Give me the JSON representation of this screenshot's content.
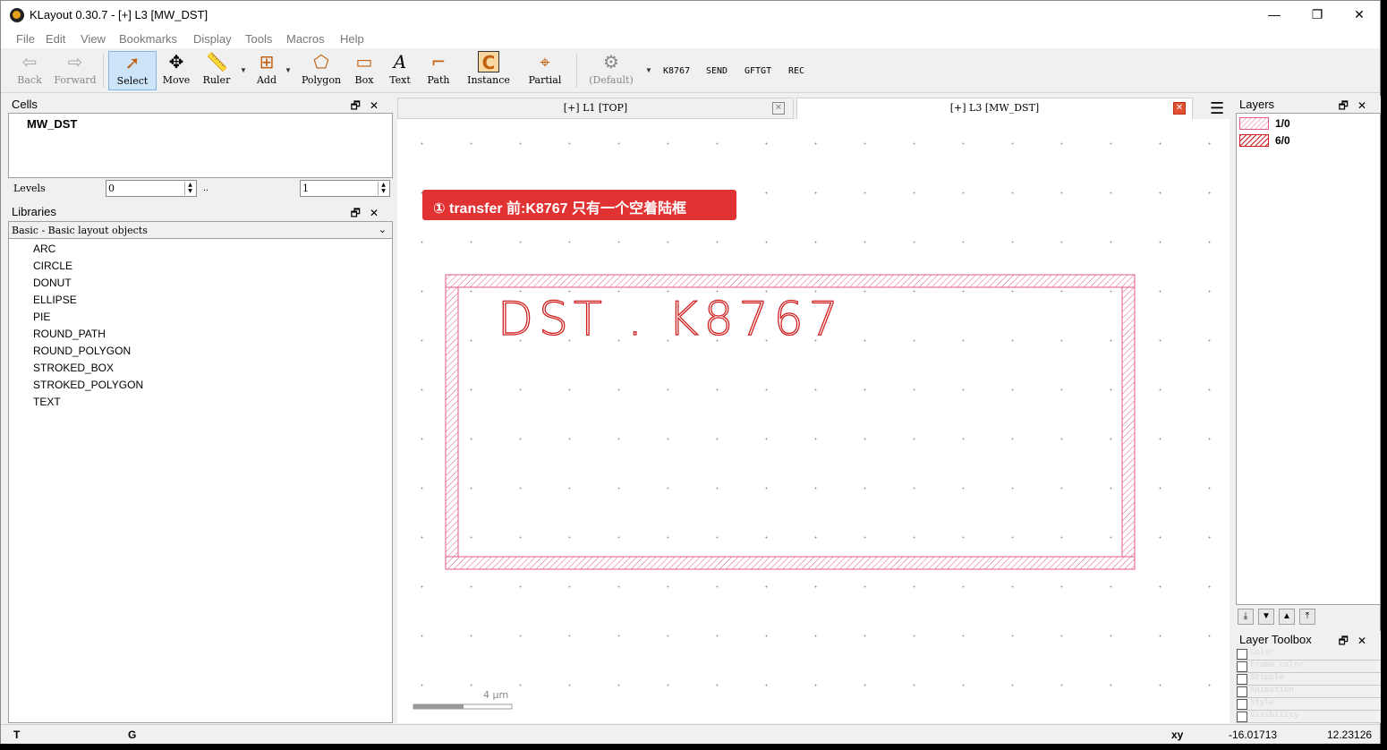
{
  "window": {
    "title": "KLayout 0.30.7 - [+] L3 [MW_DST]",
    "minimize": "—",
    "maximize": "❐",
    "close": "✕"
  },
  "menu": [
    "File",
    "Edit",
    "View",
    "Bookmarks",
    "Display",
    "Tools",
    "Macros",
    "Help"
  ],
  "toolbar": {
    "back": "Back",
    "forward": "Forward",
    "select": "Select",
    "move": "Move",
    "ruler": "Ruler",
    "add": "Add",
    "polygon": "Polygon",
    "box": "Box",
    "text": "Text",
    "path": "Path",
    "instance": "Instance",
    "partial": "Partial",
    "default": "(Default)",
    "custom": [
      "K8767",
      "SEND",
      "GFTGT",
      "REC"
    ]
  },
  "cells": {
    "title": "Cells",
    "items": [
      "MW_DST"
    ],
    "levels_label": "Levels",
    "level_from": "0",
    "level_sep": "..",
    "level_to": "1"
  },
  "libraries": {
    "title": "Libraries",
    "selected": "Basic - Basic layout objects",
    "items": [
      "ARC",
      "CIRCLE",
      "DONUT",
      "ELLIPSE",
      "PIE",
      "ROUND_PATH",
      "ROUND_POLYGON",
      "STROKED_BOX",
      "STROKED_POLYGON",
      "TEXT"
    ]
  },
  "tabs": [
    {
      "label": "[+] L1 [TOP]",
      "active": false
    },
    {
      "label": "[+] L3 [MW_DST]",
      "active": true
    }
  ],
  "canvas": {
    "banner": "① transfer 前:K8767 只有一个空着陆框",
    "layout_text": "DST . K8767",
    "scale_label": "4 µm"
  },
  "layers": {
    "title": "Layers",
    "items": [
      {
        "name": "1/0",
        "color": "#e05a8a"
      },
      {
        "name": "6/0",
        "color": "#d02020"
      }
    ]
  },
  "layer_toolbox": {
    "title": "Layer Toolbox",
    "rows": [
      "Color",
      "Frame color",
      "Stipple",
      "Animation",
      "Style",
      "Visibility"
    ]
  },
  "status": {
    "left": "T",
    "mid": "G",
    "coord_label": "xy",
    "x": "-16.01713",
    "y": "12.23126"
  },
  "colors": {
    "banner": "#e03232",
    "layout_stroke": "#e05a8a",
    "text_red": "#d02020"
  }
}
